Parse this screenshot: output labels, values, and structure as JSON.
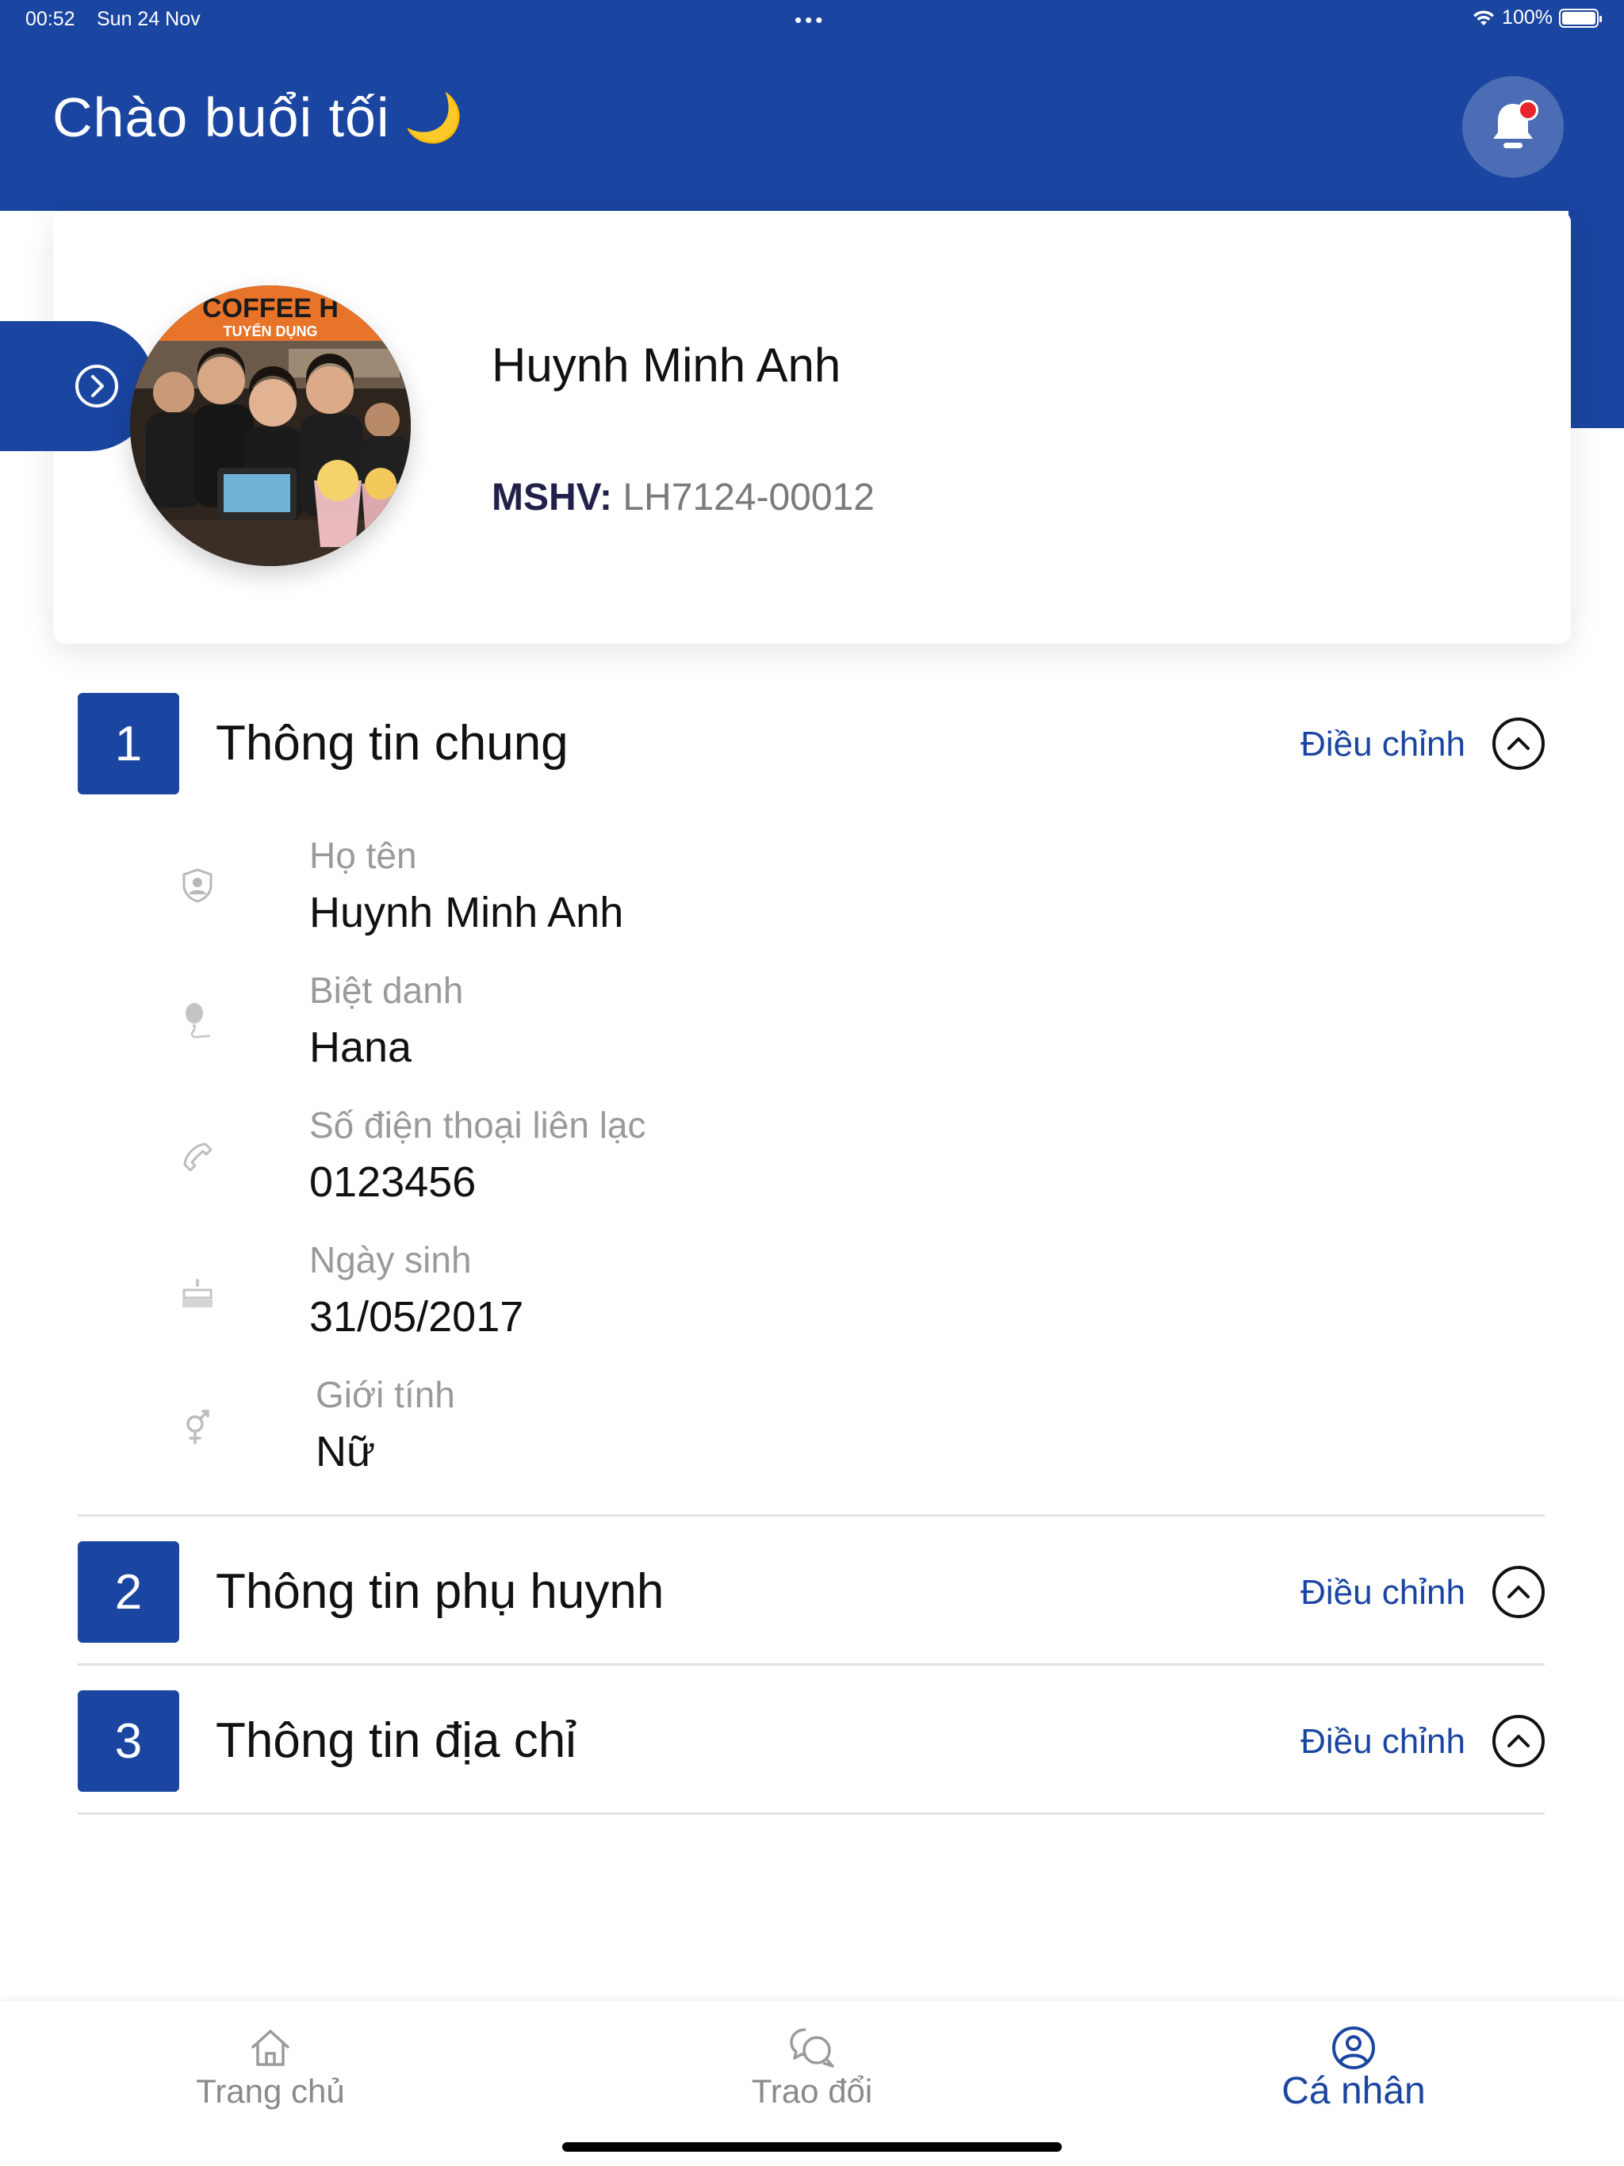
{
  "status_bar": {
    "time": "00:52",
    "date": "Sun 24 Nov",
    "dots": "•••",
    "battery": "100%",
    "battery_level": 1.0
  },
  "header": {
    "greeting": "Chào buổi tối",
    "greeting_icon": "🌙",
    "notification_badge": true
  },
  "profile": {
    "name": "Huynh Minh Anh",
    "id_label": "MSHV:",
    "id_value": "LH7124-00012",
    "avatar_sign_line1": "COFFEE H",
    "avatar_sign_line2": "TUYỂN DỤNG"
  },
  "sections": [
    {
      "number": "1",
      "title": "Thông tin chung",
      "edit_label": "Điều chỉnh",
      "fields": [
        {
          "icon": "user-shield-icon",
          "label": "Họ tên",
          "value": "Huynh Minh Anh"
        },
        {
          "icon": "balloon-icon",
          "label": "Biệt danh",
          "value": "Hana"
        },
        {
          "icon": "phone-icon",
          "label": "Số điện thoại liên lạc",
          "value": "0123456"
        },
        {
          "icon": "cake-icon",
          "label": "Ngày sinh",
          "value": "31/05/2017"
        },
        {
          "icon": "gender-icon",
          "label": "Giới tính",
          "value": "Nữ"
        }
      ]
    },
    {
      "number": "2",
      "title": "Thông tin phụ huynh",
      "edit_label": "Điều chỉnh"
    },
    {
      "number": "3",
      "title": "Thông tin địa chỉ",
      "edit_label": "Điều chỉnh"
    }
  ],
  "nav": [
    {
      "label": "Trang chủ",
      "icon": "home-icon",
      "active": false
    },
    {
      "label": "Trao đổi",
      "icon": "chat-icon",
      "active": false
    },
    {
      "label": "Cá nhân",
      "icon": "profile-icon",
      "active": true
    }
  ],
  "colors": {
    "primary": "#1A45A0",
    "badge": "#E8252C",
    "label_gray": "#9a9a9a"
  }
}
